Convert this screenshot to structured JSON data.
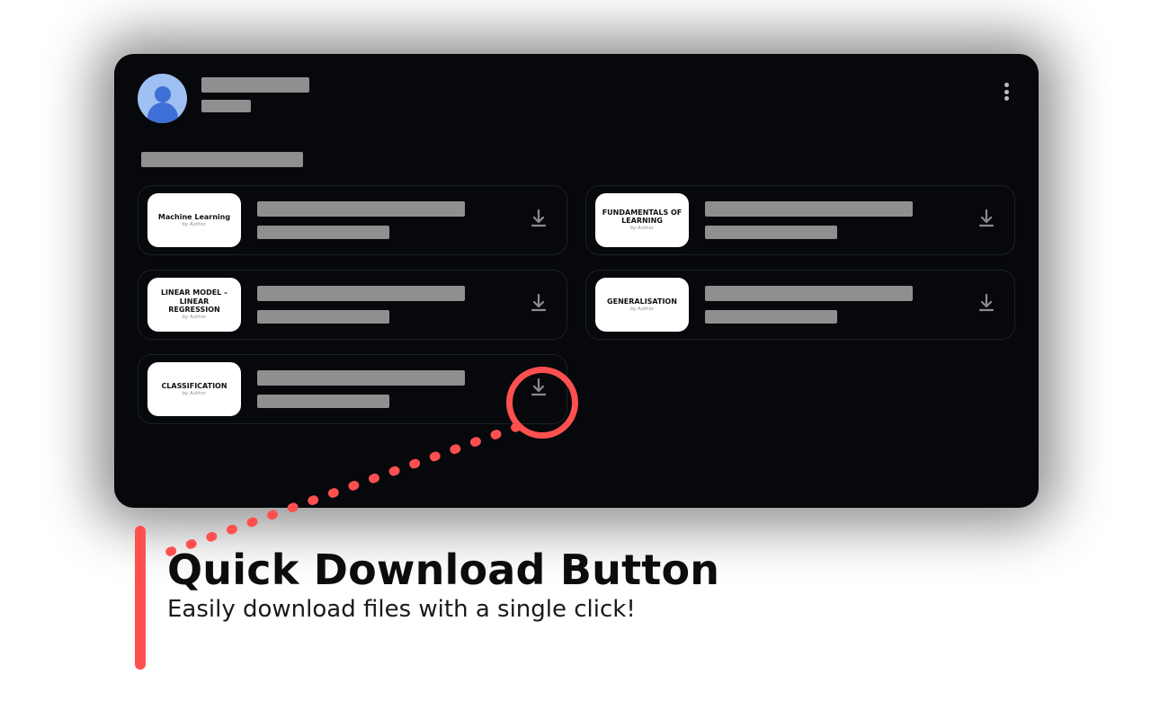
{
  "files": [
    {
      "title": "Machine Learning",
      "sub": "by Author"
    },
    {
      "title": "FUNDAMENTALS OF LEARNING",
      "sub": "by Author"
    },
    {
      "title": "LINEAR MODEL – LINEAR REGRESSION",
      "sub": "by Author"
    },
    {
      "title": "GENERALISATION",
      "sub": "by Author"
    },
    {
      "title": "CLASSIFICATION",
      "sub": "by Author"
    }
  ],
  "callout": {
    "heading": "Quick Download Button",
    "sub": "Easily download files with a single click!"
  }
}
